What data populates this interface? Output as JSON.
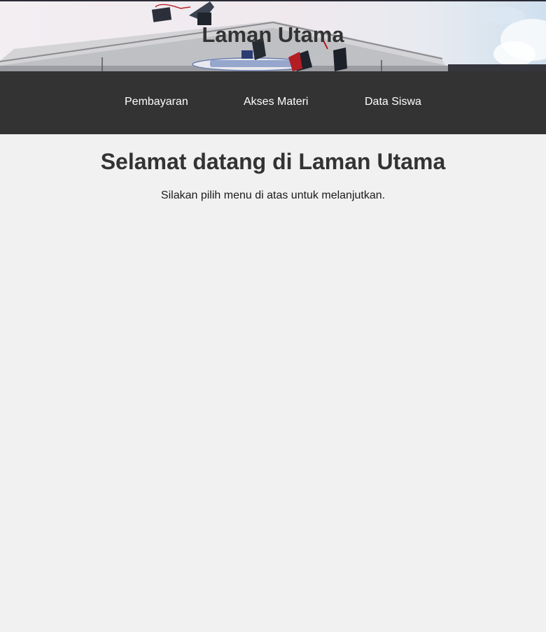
{
  "header": {
    "title": "Laman Utama",
    "background_image": "graduation-caps-building-photo"
  },
  "nav": {
    "items": [
      {
        "label": "Pembayaran"
      },
      {
        "label": "Akses Materi"
      },
      {
        "label": "Data Siswa"
      }
    ]
  },
  "main": {
    "heading": "Selamat datang di Laman Utama",
    "subtitle": "Silakan pilih menu di atas untuk melanjutkan."
  },
  "colors": {
    "nav_background": "#333333",
    "page_background": "#f1f1f1",
    "text_dark": "#333333",
    "nav_text": "#ffffff"
  }
}
